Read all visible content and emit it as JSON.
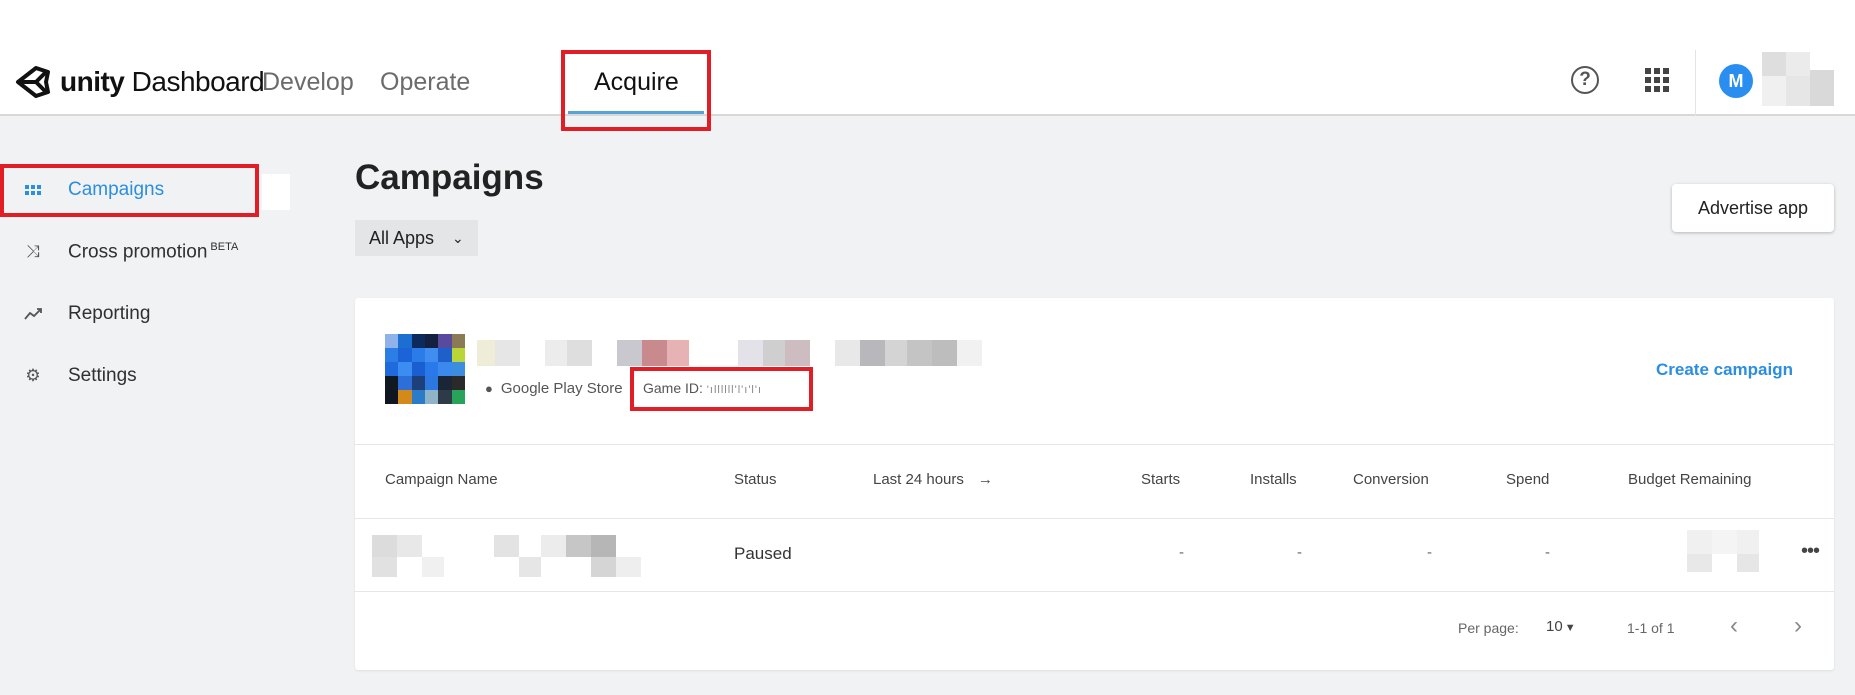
{
  "header": {
    "logo_bold": "unity",
    "logo_rest": " Dashboard",
    "tabs": [
      {
        "label": "Develop"
      },
      {
        "label": "Operate"
      },
      {
        "label": "Acquire",
        "active": true
      }
    ],
    "avatar_initial": "M",
    "help_icon": "help-circle-icon",
    "apps_icon": "apps-grid-icon"
  },
  "sidebar": {
    "items": [
      {
        "label": "Campaigns",
        "icon": "campaigns-grid-icon",
        "active": true
      },
      {
        "label": "Cross promotion",
        "badge": "BETA",
        "icon": "cross-promotion-icon"
      },
      {
        "label": "Reporting",
        "icon": "trending-icon"
      },
      {
        "label": "Settings",
        "icon": "gear-icon"
      }
    ]
  },
  "main": {
    "title": "Campaigns",
    "app_filter": "All Apps",
    "advertise_button": "Advertise app",
    "app_card": {
      "store": "Google Play Store",
      "game_id_label": "Game ID:",
      "game_id_value": "'ıllllll'l'ı'l'ı",
      "create_campaign": "Create campaign"
    },
    "table": {
      "columns": [
        "Campaign Name",
        "Status",
        "Last 24 hours",
        "Starts",
        "Installs",
        "Conversion",
        "Spend",
        "Budget Remaining"
      ],
      "rows": [
        {
          "status": "Paused",
          "starts": "-",
          "installs": "-",
          "conversion": "-",
          "spend": "-"
        }
      ]
    },
    "pagination": {
      "per_page_label": "Per page:",
      "per_page_value": "10",
      "range": "1-1 of 1"
    }
  },
  "colors": {
    "accent": "#2b8ee0",
    "highlight": "#e11d25",
    "tab_underline": "#58a3d6"
  }
}
